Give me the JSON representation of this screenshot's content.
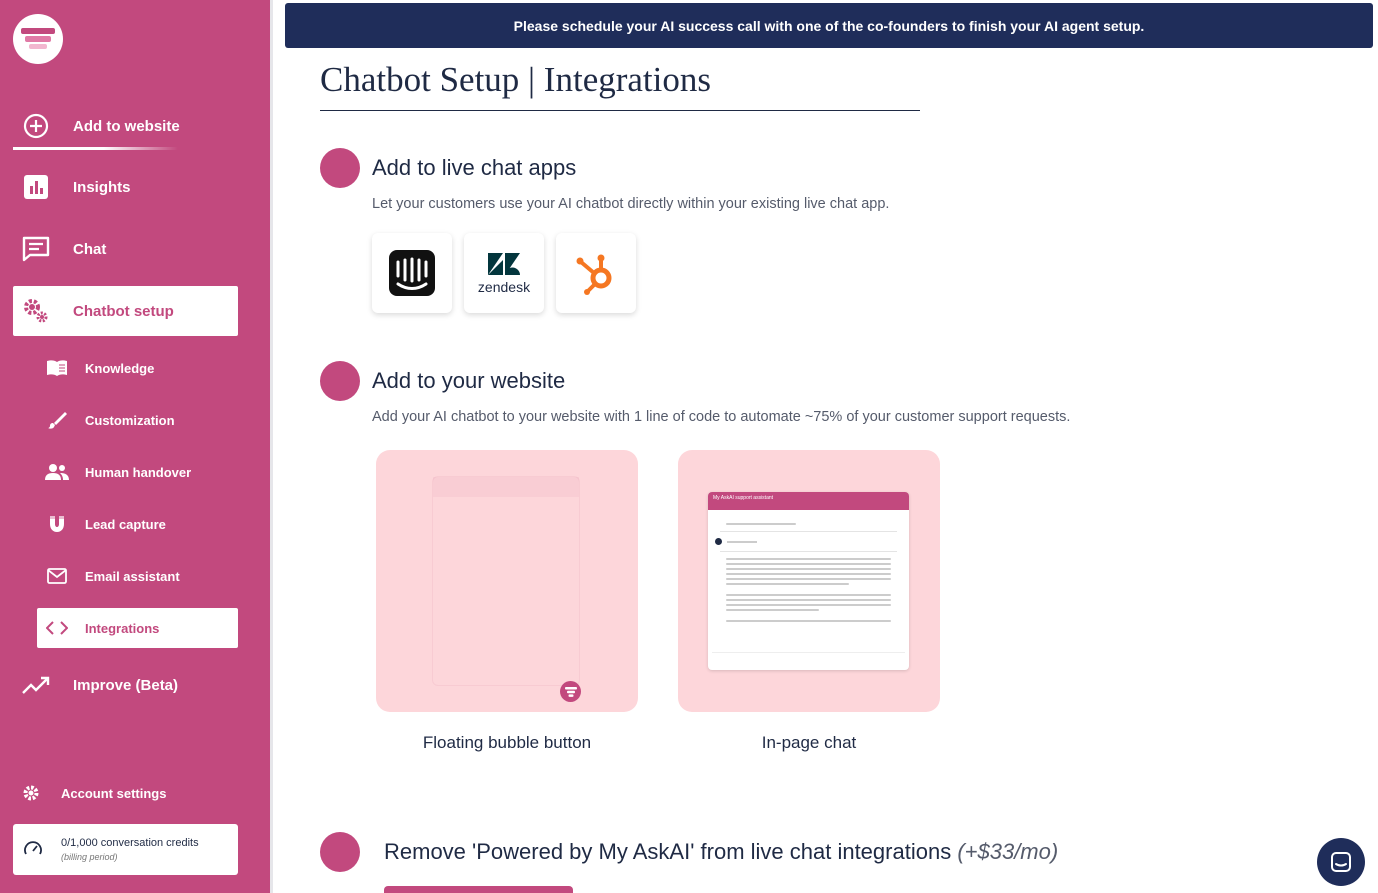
{
  "banner": {
    "text": "Please schedule your AI success call with one of the co-founders to finish your AI agent setup."
  },
  "sidebar": {
    "items": [
      {
        "label": "Add to website",
        "icon": "plus-circle-icon"
      },
      {
        "label": "Insights",
        "icon": "bar-chart-icon"
      },
      {
        "label": "Chat",
        "icon": "chat-icon"
      },
      {
        "label": "Chatbot setup",
        "icon": "gears-icon"
      },
      {
        "label": "Improve (Beta)",
        "icon": "trend-up-icon"
      }
    ],
    "subitems": [
      {
        "label": "Knowledge",
        "icon": "book-icon"
      },
      {
        "label": "Customization",
        "icon": "brush-icon"
      },
      {
        "label": "Human handover",
        "icon": "users-icon"
      },
      {
        "label": "Lead capture",
        "icon": "magnet-icon"
      },
      {
        "label": "Email assistant",
        "icon": "envelope-icon"
      },
      {
        "label": "Integrations",
        "icon": "code-icon"
      }
    ],
    "account_settings": "Account settings",
    "credits": {
      "text": "0/1,000 conversation credits",
      "period": "(billing period)"
    },
    "colors": {
      "brand": "#c2497e",
      "navy": "#1f2d5a"
    }
  },
  "main": {
    "title": "Chatbot Setup | Integrations",
    "live_chat": {
      "title": "Add to live chat apps",
      "description": "Let your customers use your AI chatbot directly within your existing live chat app.",
      "apps": [
        {
          "name": "intercom-logo"
        },
        {
          "name": "zendesk-logo",
          "label": "zendesk"
        },
        {
          "name": "hubspot-logo"
        }
      ]
    },
    "website": {
      "title": "Add to your website",
      "description": "Add your AI chatbot to your website with 1 line of code to automate ~75% of your customer support requests.",
      "options": [
        {
          "label": "Floating bubble button"
        },
        {
          "label": "In-page chat"
        }
      ],
      "mini_chat_title": "My AskAI support assistant"
    },
    "remove_branding": {
      "title": "Remove 'Powered by My AskAI' from live chat integrations",
      "price": "(+$33/mo)"
    }
  }
}
